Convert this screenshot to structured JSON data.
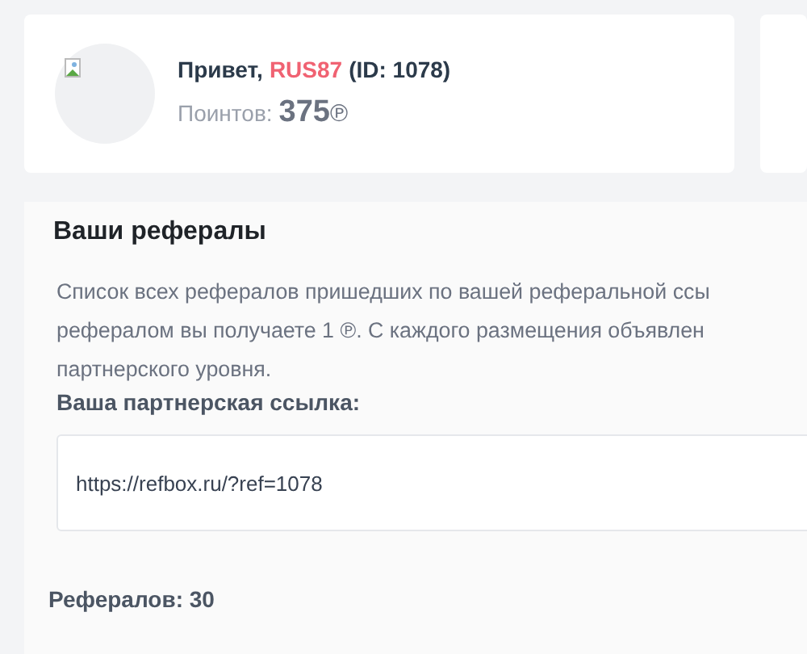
{
  "profile": {
    "greeting": "Привет,",
    "username": "RUS87",
    "user_id": "(ID: 1078)",
    "points_label": "Поинтов:",
    "points_value": "375",
    "points_unit": "℗"
  },
  "referrals": {
    "title": "Ваши рефералы",
    "description_lines": [
      "Список всех рефералов пришедших по вашей реферальной ссы",
      "рефералом вы получаете 1 ℗. С каждого размещения объявлен",
      "партнерского уровня."
    ],
    "link_label": "Ваша партнерская ссылка:",
    "link_value": "https://refbox.ru/?ref=1078",
    "count": "Рефералов: 30"
  }
}
